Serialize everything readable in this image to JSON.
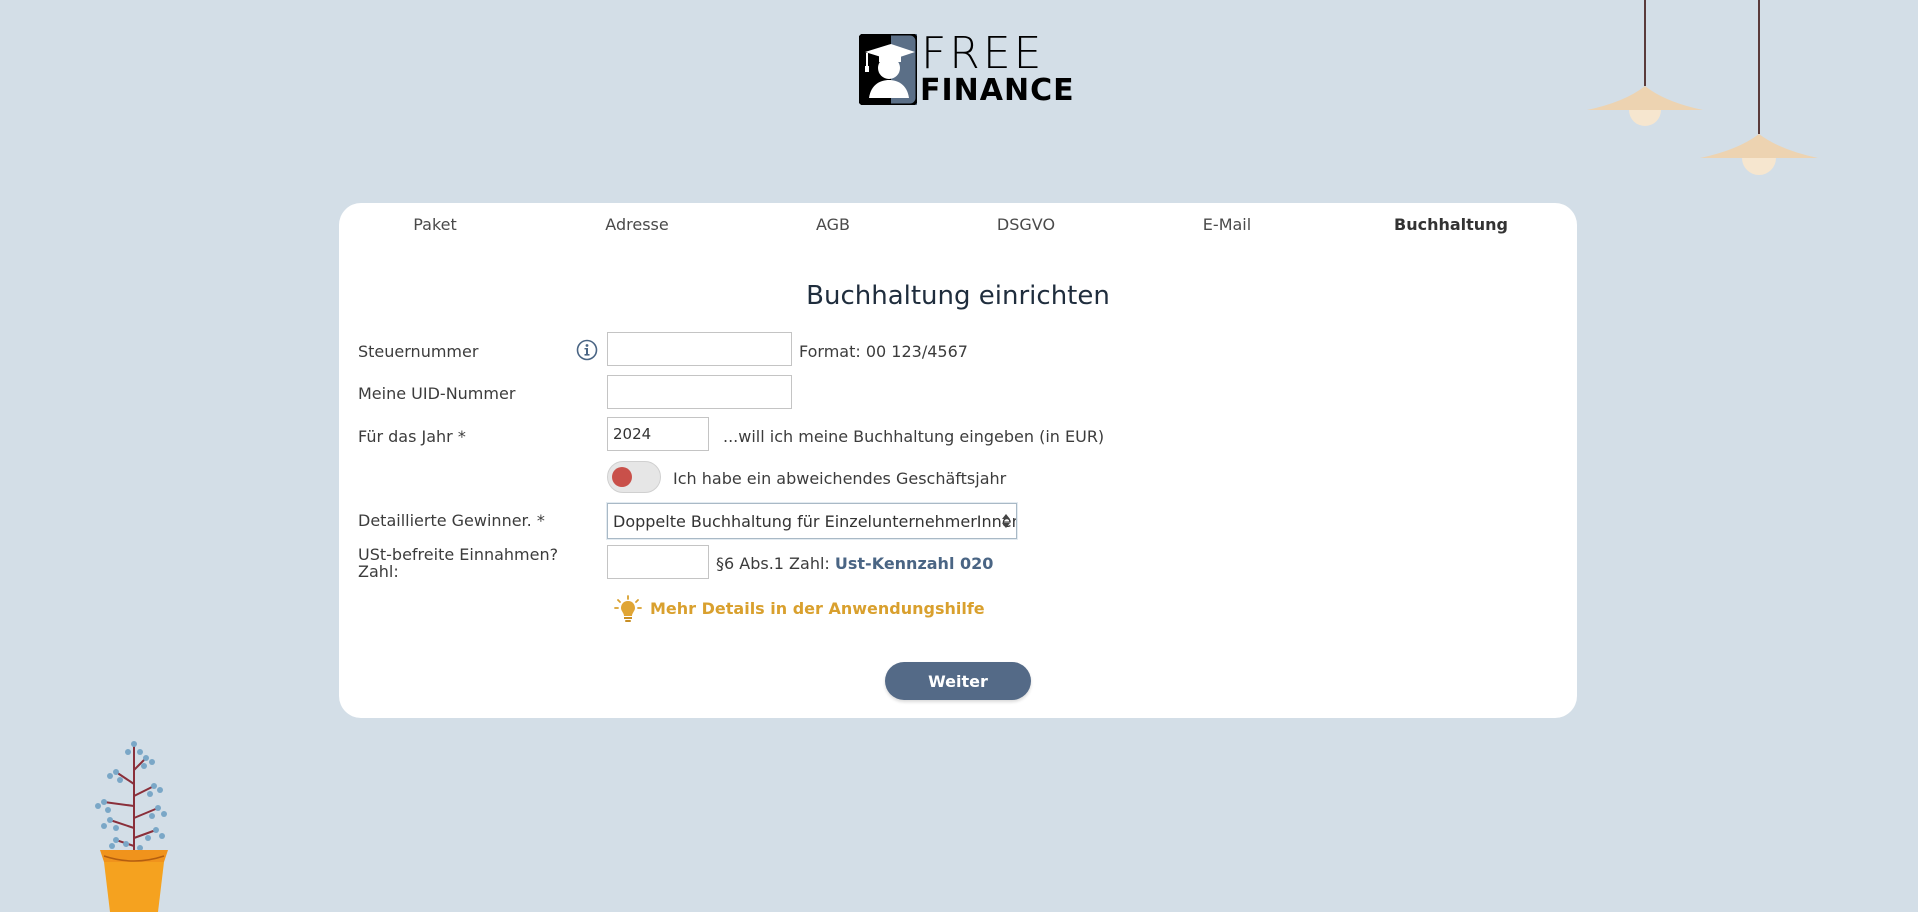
{
  "logo": {
    "line1": "FREE",
    "line2": "FINANCE"
  },
  "tabs": [
    {
      "label": "Paket",
      "active": false
    },
    {
      "label": "Adresse",
      "active": false
    },
    {
      "label": "AGB",
      "active": false
    },
    {
      "label": "DSGVO",
      "active": false
    },
    {
      "label": "E-Mail",
      "active": false
    },
    {
      "label": "Buchhaltung",
      "active": true
    }
  ],
  "form": {
    "heading": "Buchhaltung einrichten",
    "steuernummer": {
      "label": "Steuernummer",
      "value": "",
      "hint": "Format: 00 123/4567"
    },
    "uid": {
      "label": "Meine UID-Nummer",
      "value": ""
    },
    "jahr": {
      "label": "Für das Jahr *",
      "value": "2024",
      "hint": "...will ich meine Buchhaltung eingeben (in EUR)"
    },
    "geschaeftsjahr": {
      "label": "Ich habe ein abweichendes Geschäftsjahr",
      "enabled": false
    },
    "gewinner": {
      "label": "Detaillierte Gewinner. *",
      "selected": "Doppelte Buchhaltung für EinzelunternehmerInnen (I"
    },
    "ust": {
      "label_line1": "USt-befreite Einnahmen?",
      "label_line2": "Zahl:",
      "value": "",
      "hint": "§6 Abs.1 Zahl:",
      "link": "Ust-Kennzahl 020"
    },
    "help": "Mehr Details in der Anwendungshilfe",
    "submit": "Weiter"
  },
  "colors": {
    "background": "#d3dee7",
    "button": "#546a87",
    "toggle_off": "#c9504a",
    "help": "#d9a02e",
    "link": "#4a6584"
  }
}
